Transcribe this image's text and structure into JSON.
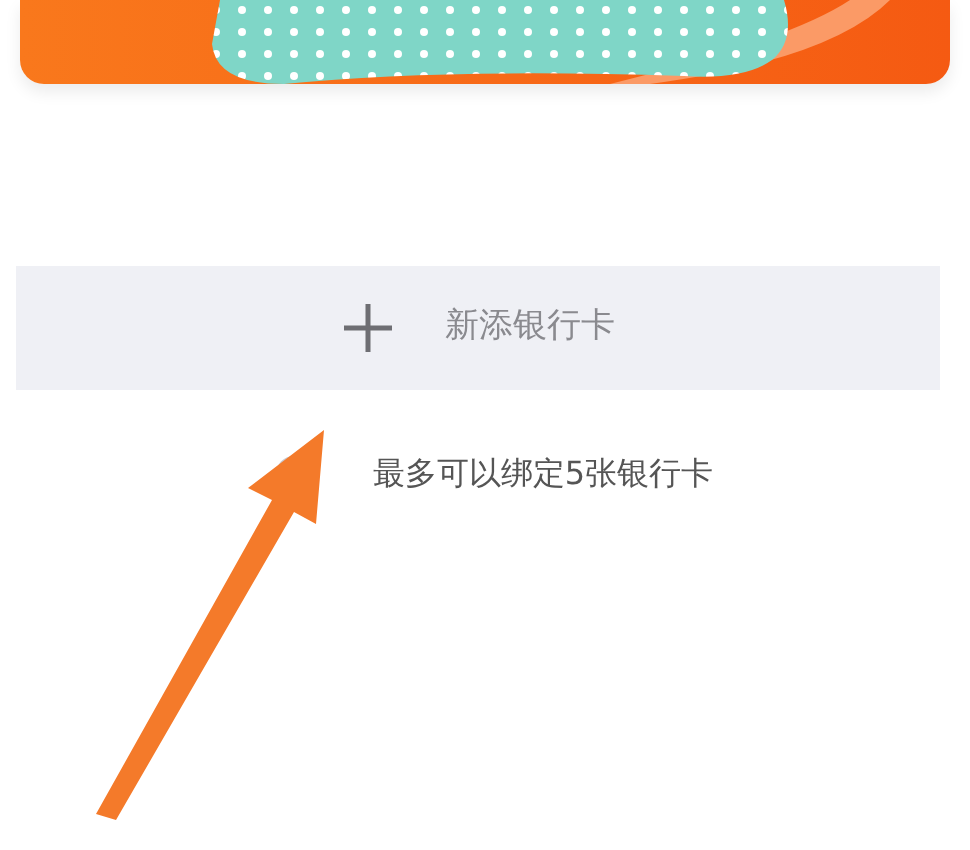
{
  "add_card_button": {
    "label": "新添银行卡"
  },
  "notice": {
    "text": "最多可以绑定5张银行卡"
  }
}
